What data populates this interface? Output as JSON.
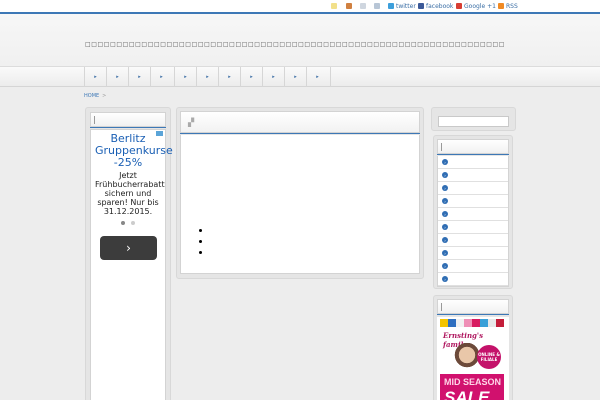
{
  "topbar": {
    "links": [
      {
        "label": "twitter",
        "icon": "twitter-icon",
        "color": "#3d9fdb"
      },
      {
        "label": "facebook",
        "icon": "facebook-icon",
        "color": "#3b5998"
      },
      {
        "label": "Google +1",
        "icon": "googleplus-icon",
        "color": "#d73d32"
      },
      {
        "label": "RSS",
        "icon": "rss-icon",
        "color": "#f08a24"
      }
    ]
  },
  "header": {
    "description": "□□□□□□□□□□□□□□□□□□□□□□□□□□□□□□□□□□□□□□□□□□□□□□□□□□□□□□□□□□□□□□□□□□□□□□□□□□□□□□□□□□□□"
  },
  "nav": {
    "items": [
      "▸",
      "▸",
      "▸",
      "▸",
      "▸",
      "▸",
      "▸",
      "▸",
      "▸",
      "▸",
      "▸"
    ]
  },
  "breadcrumb": {
    "home": "HOME",
    "sep": ">"
  },
  "ad_left": {
    "title": "Berlitz Gruppenkurse -25%",
    "text": "Jetzt Frühbucherrabatt sichern und sparen! Nur bis 31.12.2015.",
    "button": "›"
  },
  "ad_right": {
    "brand": "Ernsting's family",
    "badge": "ONLINE & FILIALE",
    "line1": "MID SEASON",
    "line2": "SALE"
  },
  "colors": {
    "accent": "#3d78b6",
    "sale": "#d1116e"
  }
}
